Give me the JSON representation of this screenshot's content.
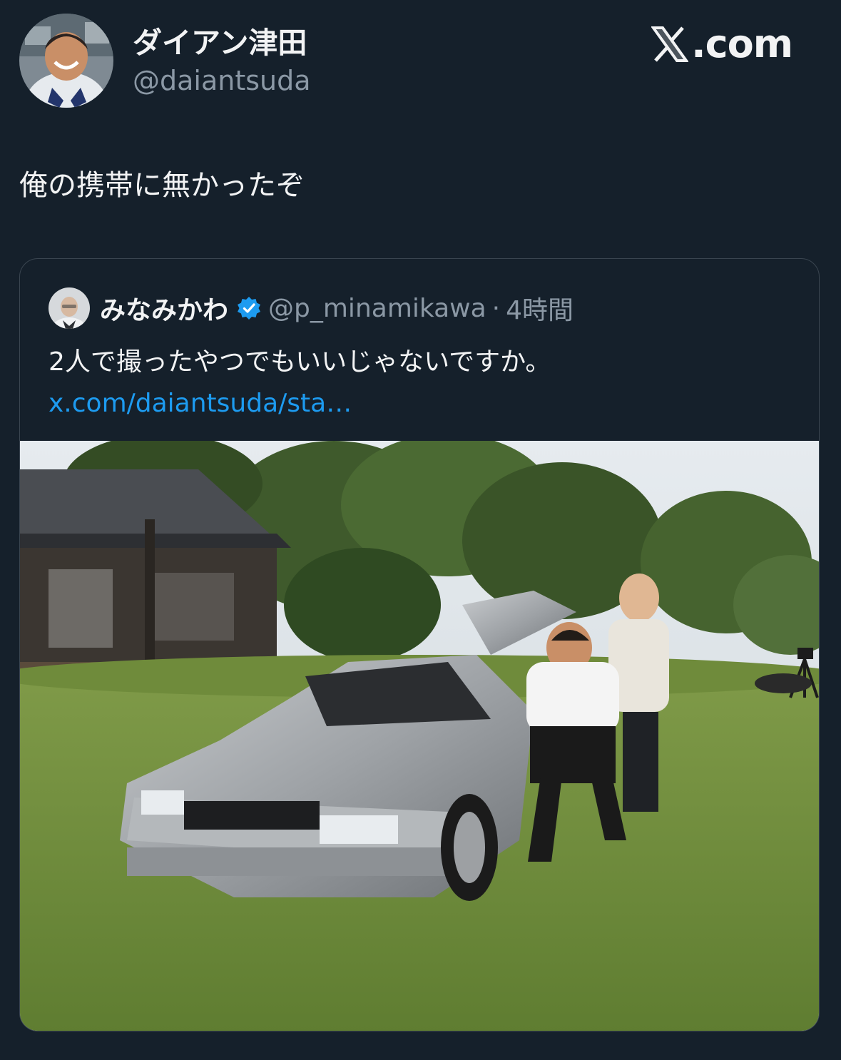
{
  "header": {
    "display_name": "ダイアン津田",
    "handle": "@daiantsuda",
    "brand": ".com",
    "avatar_icon": "user-avatar-icon"
  },
  "tweet": {
    "text": "俺の携帯に無かったぞ"
  },
  "quote": {
    "display_name": "みなみかわ",
    "handle": "@p_minamikawa",
    "separator": "·",
    "time": "4時間",
    "text": "2人で撮ったやつでもいいじゃないですか。",
    "link": "x.com/daiantsuda/sta…",
    "verified_icon": "verified-badge-icon"
  },
  "colors": {
    "background": "#15202b",
    "secondary_text": "#8b98a5",
    "link": "#1d9bf0"
  }
}
